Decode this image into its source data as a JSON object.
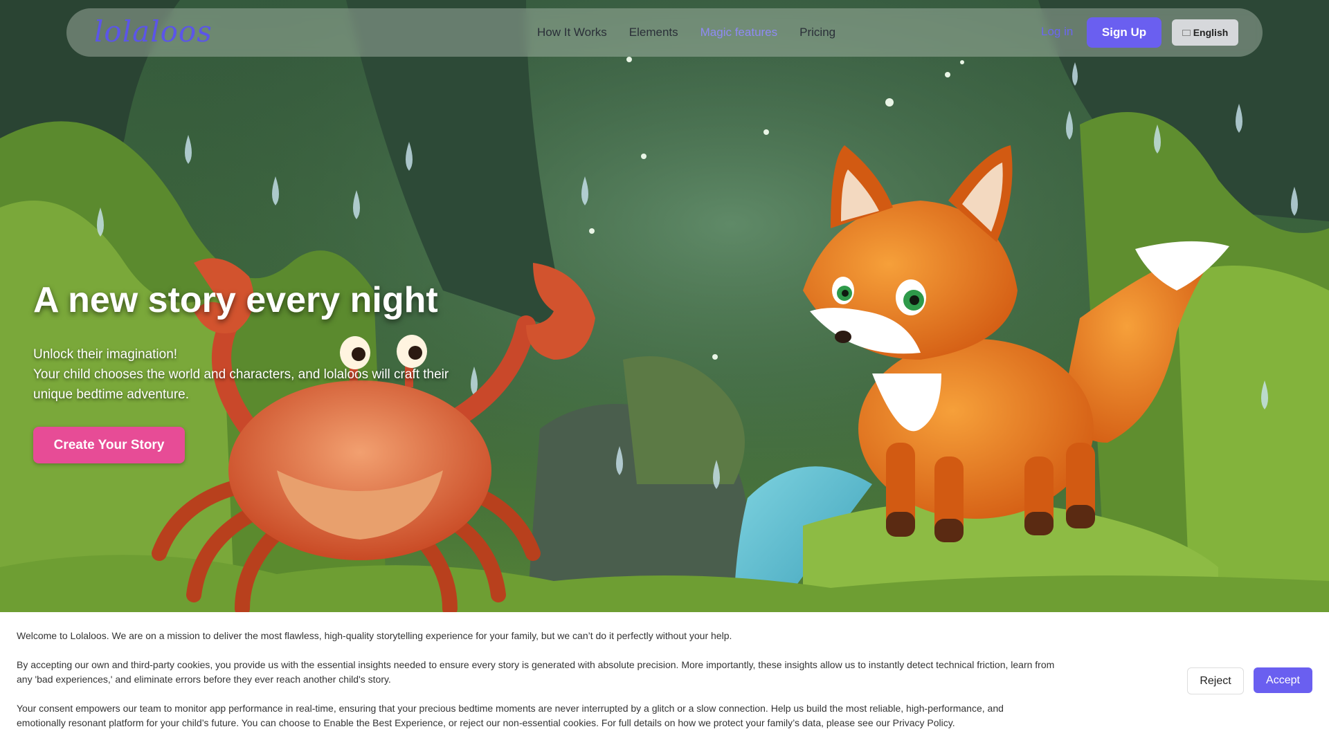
{
  "nav": {
    "logo": "lolaloos",
    "links": [
      {
        "label": "How It Works"
      },
      {
        "label": "Elements"
      },
      {
        "label": "Magic features"
      },
      {
        "label": "Pricing"
      }
    ],
    "login": "Log in",
    "signup": "Sign Up",
    "language": "English",
    "language_icon": "flag-icon"
  },
  "hero": {
    "title": "A new story every night",
    "subtitle_line1": "Unlock their imagination!",
    "subtitle_line2": "Your child chooses the world and characters, and lolaloos will craft their unique bedtime adventure.",
    "cta": "Create Your Story",
    "image_subject": "cartoon crab and fox in a rainy mossy forest"
  },
  "cookie": {
    "p1": "Welcome to Lolaloos. We are on a mission to deliver the most flawless, high-quality storytelling experience for your family, but we can’t do it perfectly without your help.",
    "p2": "By accepting our own and third-party cookies, you provide us with the essential insights needed to ensure every story is generated with absolute precision. More importantly, these insights allow us to instantly detect technical friction, learn from any 'bad experiences,' and eliminate errors before they ever reach another child's story.",
    "p3": "Your consent empowers our team to monitor app performance in real-time, ensuring that your precious bedtime moments are never interrupted by a glitch or a slow connection. Help us build the most reliable, high-performance, and emotionally resonant platform for your child’s future. You can choose to Enable the Best Experience, or reject our non-essential cookies. For full details on how we protect your family’s data, please see our Privacy Policy.",
    "reject": "Reject",
    "accept": "Accept"
  },
  "colors": {
    "brand": "#6a5ff0",
    "cta": "#e74c96",
    "nav_active": "#8f8af5"
  }
}
